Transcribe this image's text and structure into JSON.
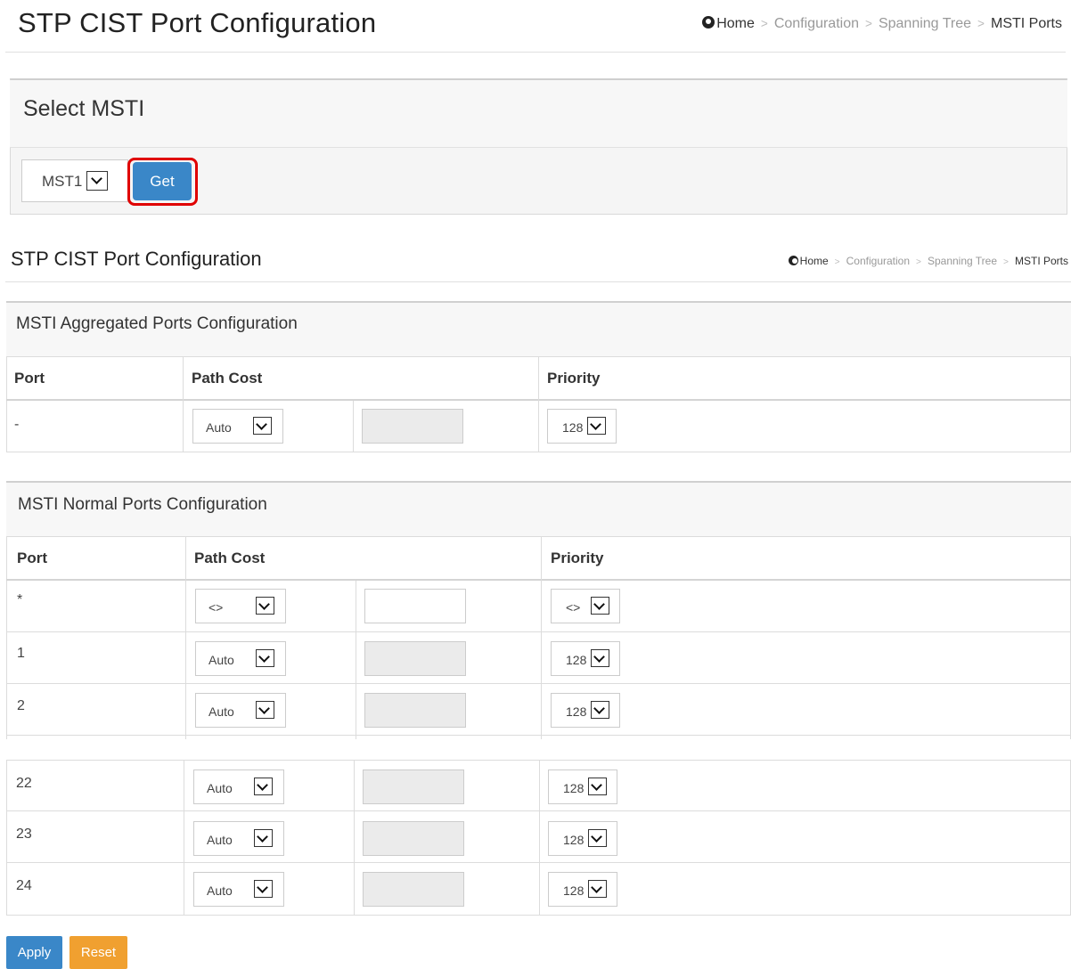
{
  "header": {
    "title": "STP CIST Port Configuration",
    "breadcrumb": [
      "Home",
      "Configuration",
      "Spanning Tree",
      "MSTI Ports"
    ],
    "separator": ">"
  },
  "select_msti": {
    "title": "Select MSTI",
    "selected": "MST1",
    "get_label": "Get"
  },
  "aggregated": {
    "title": "MSTI Aggregated Ports Configuration",
    "columns": [
      "Port",
      "Path Cost",
      "Priority"
    ],
    "row": {
      "port": "-",
      "path_cost": "Auto",
      "path_value": "",
      "priority": "128"
    }
  },
  "normal": {
    "title": "MSTI Normal Ports Configuration",
    "columns": [
      "Port",
      "Path Cost",
      "Priority"
    ],
    "rows": [
      {
        "port": "*",
        "path_cost": "<>",
        "priority": "<>"
      },
      {
        "port": "1",
        "path_cost": "Auto",
        "priority": "128"
      },
      {
        "port": "2",
        "path_cost": "Auto",
        "priority": "128"
      },
      {
        "port": "22",
        "path_cost": "Auto",
        "priority": "128"
      },
      {
        "port": "23",
        "path_cost": "Auto",
        "priority": "128"
      },
      {
        "port": "24",
        "path_cost": "Auto",
        "priority": "128"
      }
    ]
  },
  "buttons": {
    "apply": "Apply",
    "reset": "Reset"
  },
  "colors": {
    "primary": "#3a87c8",
    "warning": "#f0a030",
    "highlight": "#e00000"
  }
}
